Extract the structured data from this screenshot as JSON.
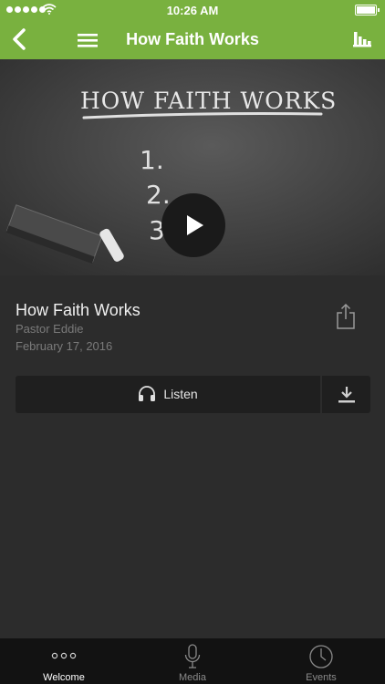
{
  "status_bar": {
    "time": "10:26 AM"
  },
  "nav": {
    "title": "How Faith Works"
  },
  "hero": {
    "chalk_title": "HOW FAITH WORKS",
    "list": [
      "1.",
      "2.",
      "3."
    ]
  },
  "media": {
    "title": "How Faith Works",
    "speaker": "Pastor Eddie",
    "date": "February 17, 2016",
    "listen_label": "Listen"
  },
  "tabs": [
    {
      "label": "Welcome",
      "icon": "ellipsis-icon",
      "active": true
    },
    {
      "label": "Media",
      "icon": "microphone-icon",
      "active": false
    },
    {
      "label": "Events",
      "icon": "clock-icon",
      "active": false
    }
  ],
  "colors": {
    "accent": "#79b13f",
    "background": "#2c2c2c",
    "tabbar": "#121212"
  }
}
